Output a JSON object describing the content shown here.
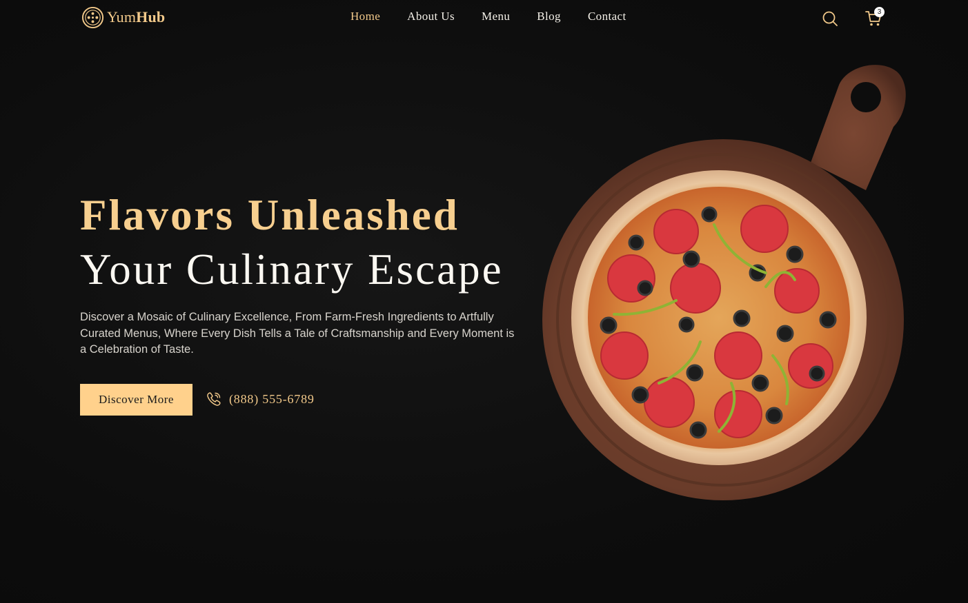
{
  "header": {
    "logo": {
      "part1": "Yum",
      "part2": "Hub"
    },
    "nav": [
      {
        "label": "Home",
        "active": true
      },
      {
        "label": "About Us",
        "active": false
      },
      {
        "label": "Menu",
        "active": false
      },
      {
        "label": "Blog",
        "active": false
      },
      {
        "label": "Contact",
        "active": false
      }
    ],
    "icons": {
      "search": "search-icon",
      "cart": "cart-icon"
    },
    "cart_count": "3"
  },
  "hero": {
    "title_line1": "Flavors Unleashed",
    "title_line2": "Your Culinary Escape",
    "description": "Discover a Mosaic of Culinary Excellence, From Farm-Fresh Ingredients to Artfully Curated Menus, Where Every Dish Tells a Tale of Craftsmanship and Every Moment is a Celebration of Taste.",
    "cta_label": "Discover More",
    "phone": "(888) 555-6789",
    "phone_icon": "phone-icon",
    "image": "pizza-on-wooden-board"
  },
  "colors": {
    "background": "#0d0d0d",
    "accent": "#f7cf8f",
    "button": "#ffd18c",
    "text": "#fbf8f2"
  }
}
